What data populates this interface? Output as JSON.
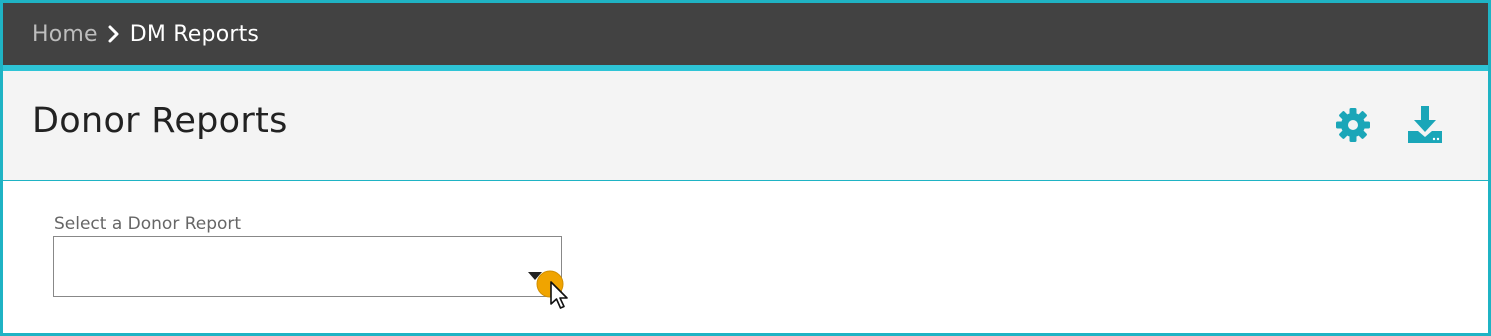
{
  "breadcrumb": {
    "home": "Home",
    "current": "DM Reports"
  },
  "header": {
    "title": "Donor Reports",
    "icons": [
      "gear-icon",
      "download-icon"
    ]
  },
  "form": {
    "label": "Select a Donor Report",
    "selected_value": ""
  },
  "colors": {
    "accent": "#1fb3c4",
    "topbar": "#424242",
    "title_bg": "#f4f4f4",
    "cursor_highlight": "#f0a400"
  }
}
